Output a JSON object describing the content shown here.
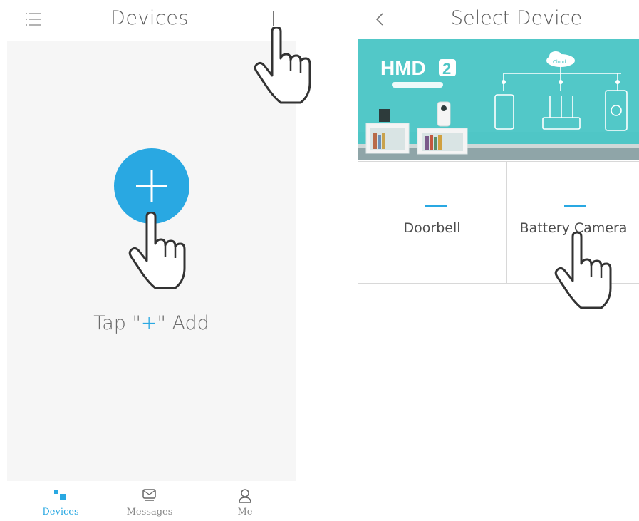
{
  "left_screen": {
    "header": {
      "title": "Devices"
    },
    "empty_state": {
      "tap_prefix": "Tap \"",
      "tap_plus": "+",
      "tap_suffix": "\" Add"
    },
    "tabs": [
      {
        "label": "Devices",
        "icon": "devices-icon",
        "active": true
      },
      {
        "label": "Messages",
        "icon": "messages-icon",
        "active": false
      },
      {
        "label": "Me",
        "icon": "person-icon",
        "active": false
      }
    ]
  },
  "right_screen": {
    "header": {
      "title": "Select Device"
    },
    "banner": {
      "brand": "HMD",
      "brand_badge": "2",
      "cloud_label": "Cloud"
    },
    "devices": [
      {
        "label": "Doorbell"
      },
      {
        "label": "Battery Camera"
      }
    ]
  },
  "colors": {
    "accent": "#29a8e2",
    "panel_bg": "#f6f6f6",
    "banner_bg": "#4fc6c6"
  }
}
